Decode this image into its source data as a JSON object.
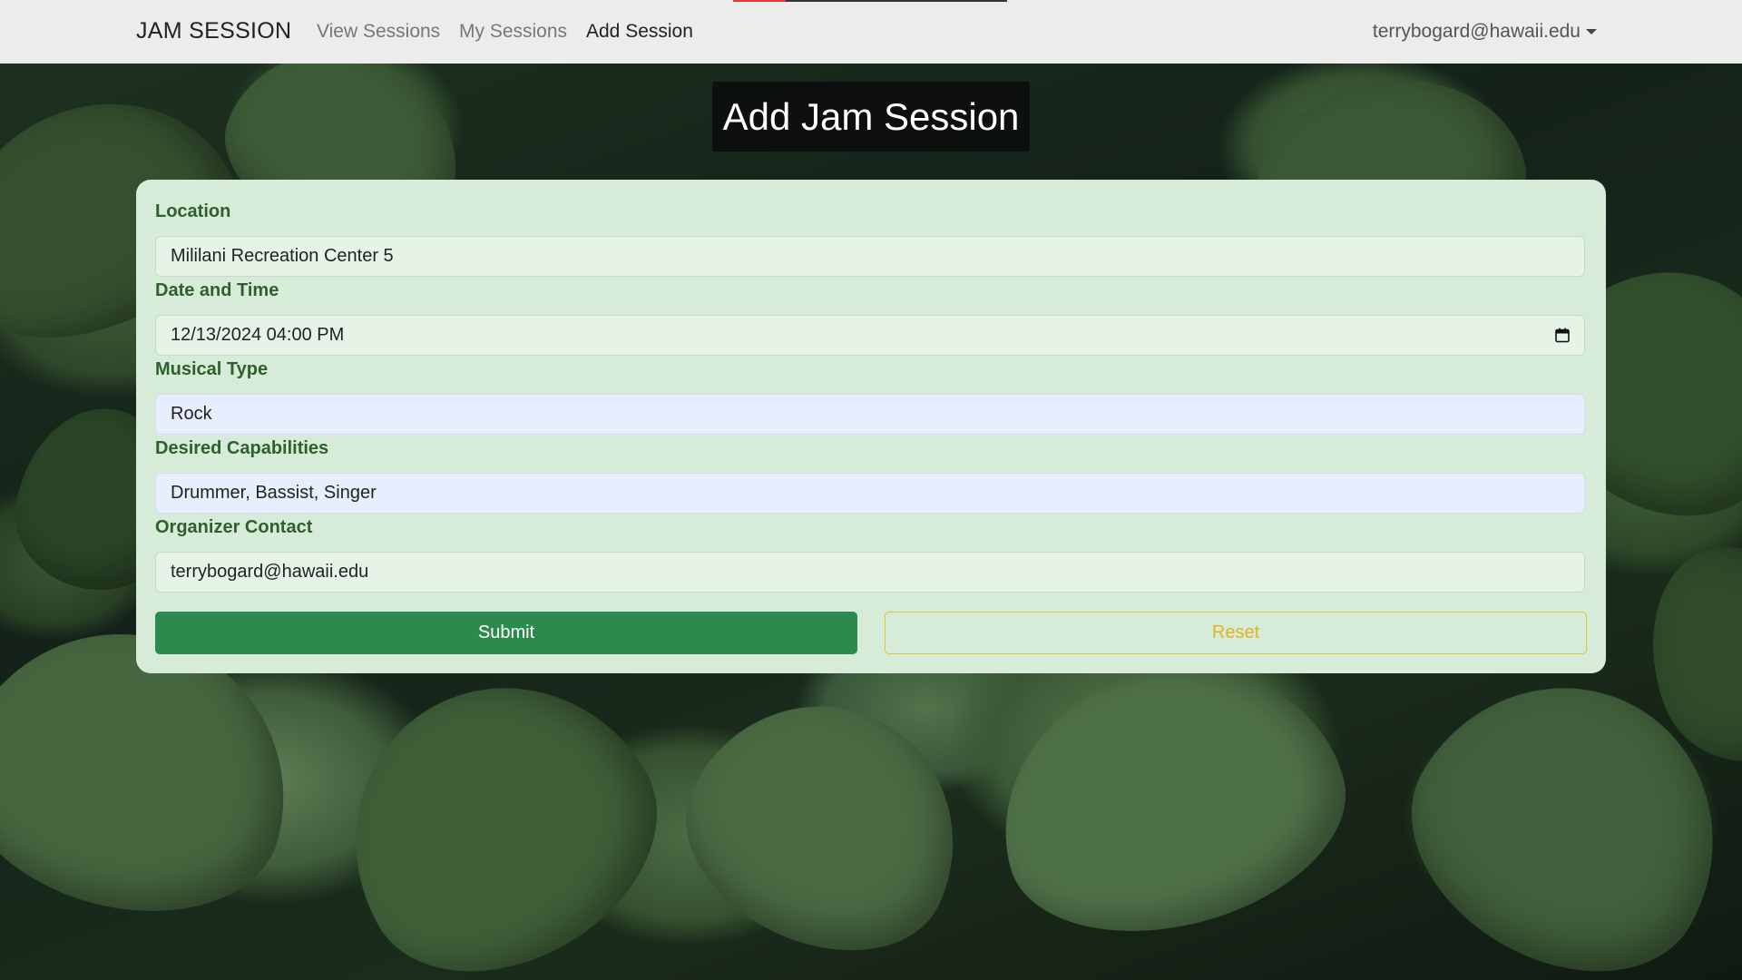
{
  "nav": {
    "brand": "JAM SESSION",
    "links": [
      "View Sessions",
      "My Sessions",
      "Add Session"
    ],
    "active": "Add Session",
    "user": "terrybogard@hawaii.edu"
  },
  "page": {
    "title": "Add Jam Session"
  },
  "form": {
    "location": {
      "label": "Location",
      "value": "Mililani Recreation Center 5"
    },
    "datetime": {
      "label": "Date and Time",
      "value": "12/13/2024 04:00 PM"
    },
    "musical_type": {
      "label": "Musical Type",
      "value": "Rock"
    },
    "capabilities": {
      "label": "Desired Capabilities",
      "value": "Drummer, Bassist, Singer"
    },
    "contact": {
      "label": "Organizer Contact",
      "value": "terrybogard@hawaii.edu"
    },
    "submit_label": "Submit",
    "reset_label": "Reset"
  },
  "icons": {
    "calendar": "calendar-icon",
    "dropdown": "chevron-down-icon"
  },
  "colors": {
    "navbar_bg": "#ececec",
    "card_bg": "#d6ecd8",
    "label_green": "#2e5f2d",
    "submit_green": "#2d8a4e",
    "reset_yellow": "#e8c02e",
    "progress_red": "#e53935"
  }
}
